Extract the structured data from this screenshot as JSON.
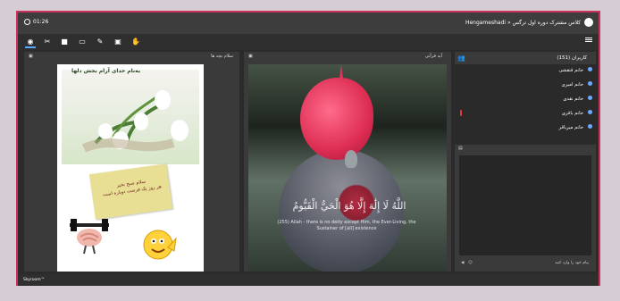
{
  "topbar": {
    "time": "01:26",
    "title": "Hengameshadi » کلاس مشترک دوره اول ترگس"
  },
  "toolbar": {
    "icons": [
      "speaker-icon",
      "mic-off-icon",
      "camera-icon",
      "screen-icon",
      "pen-icon",
      "record-icon",
      "hand-icon",
      "menu-icon"
    ]
  },
  "left_panel": {
    "label": "سلام بچه ها",
    "document": {
      "title": "بەنام خدای آرام بخش دلها",
      "note_line1": "سلام صبح بخیر",
      "note_line2": "هر روز یک فرصت دوباره است"
    }
  },
  "middle_panel": {
    "label": "آیه قرآنی",
    "verse": "اللَّهُ لَا إِلَٰهَ إِلَّا هُوَ الْحَيُّ الْقَيُّومُ",
    "subtitle": "(255) Allah - there is no deity except Him, the Ever-Living, the Sustainer of [all] existence"
  },
  "users_panel": {
    "title": "کاربران (151)",
    "users": [
      {
        "name": "خانم قنقشی",
        "mic": false
      },
      {
        "name": "خانم امیری",
        "mic": false
      },
      {
        "name": "خانم نقدی",
        "mic": false
      },
      {
        "name": "خانم باقری",
        "mic": true
      },
      {
        "name": "خانم میرباقر",
        "mic": false
      }
    ]
  },
  "chat_panel": {
    "placeholder": "پیام خود را وارد کنید"
  },
  "footer": {
    "brand": "Skyroom™"
  }
}
